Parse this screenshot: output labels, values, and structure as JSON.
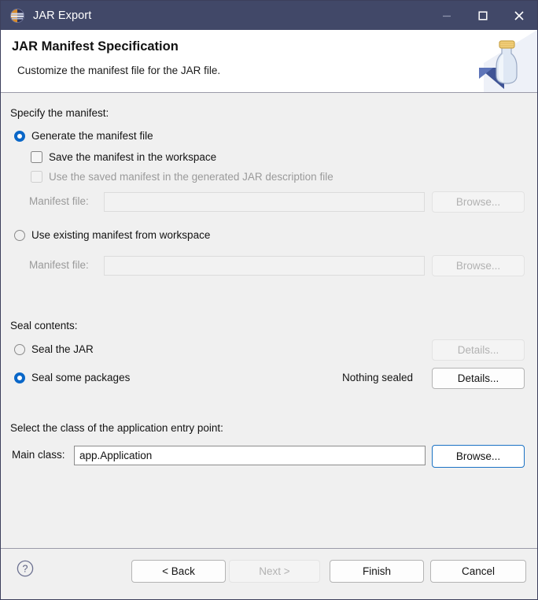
{
  "window": {
    "title": "JAR Export",
    "app_icon": "jar-export-icon",
    "controls": {
      "minimize": "minimize-icon",
      "maximize": "maximize-icon",
      "close": "close-icon"
    },
    "colors": {
      "titlebar_bg": "#414868",
      "content_bg": "#f0f0f0",
      "accent": "#0a67c8",
      "focus_border": "#1a72c4"
    }
  },
  "header": {
    "title": "JAR Manifest Specification",
    "subtitle": "Customize the manifest file for the JAR file.",
    "banner_icon": "jar-bottle-icon"
  },
  "manifest_section": {
    "label": "Specify the manifest:",
    "generate_radio": {
      "label": "Generate the manifest file",
      "checked": true,
      "enabled": true
    },
    "save_checkbox": {
      "label": "Save the manifest in the workspace",
      "checked": false,
      "enabled": true
    },
    "use_saved_checkbox": {
      "label": "Use the saved manifest in the generated JAR description file",
      "checked": false,
      "enabled": false
    },
    "generate_manifest_file": {
      "label": "Manifest file:",
      "value": "",
      "enabled": false,
      "browse_label": "Browse...",
      "browse_enabled": false
    },
    "existing_radio": {
      "label": "Use existing manifest from workspace",
      "checked": false,
      "enabled": true
    },
    "existing_manifest_file": {
      "label": "Manifest file:",
      "value": "",
      "enabled": false,
      "browse_label": "Browse...",
      "browse_enabled": false
    }
  },
  "seal_section": {
    "label": "Seal contents:",
    "seal_jar_radio": {
      "label": "Seal the JAR",
      "checked": false,
      "enabled": true
    },
    "seal_jar_details": {
      "label": "Details...",
      "enabled": false
    },
    "seal_packages_radio": {
      "label": "Seal some packages",
      "checked": true,
      "enabled": true
    },
    "seal_status": "Nothing sealed",
    "seal_packages_details": {
      "label": "Details...",
      "enabled": true
    }
  },
  "entry_point_section": {
    "label": "Select the class of the application entry point:",
    "main_class_label": "Main class:",
    "main_class_value": "app.Application",
    "browse_label": "Browse...",
    "browse_focused": true
  },
  "footer": {
    "help_icon": "help-icon",
    "back_label": "< Back",
    "next_label": "Next >",
    "next_enabled": false,
    "finish_label": "Finish",
    "cancel_label": "Cancel"
  }
}
